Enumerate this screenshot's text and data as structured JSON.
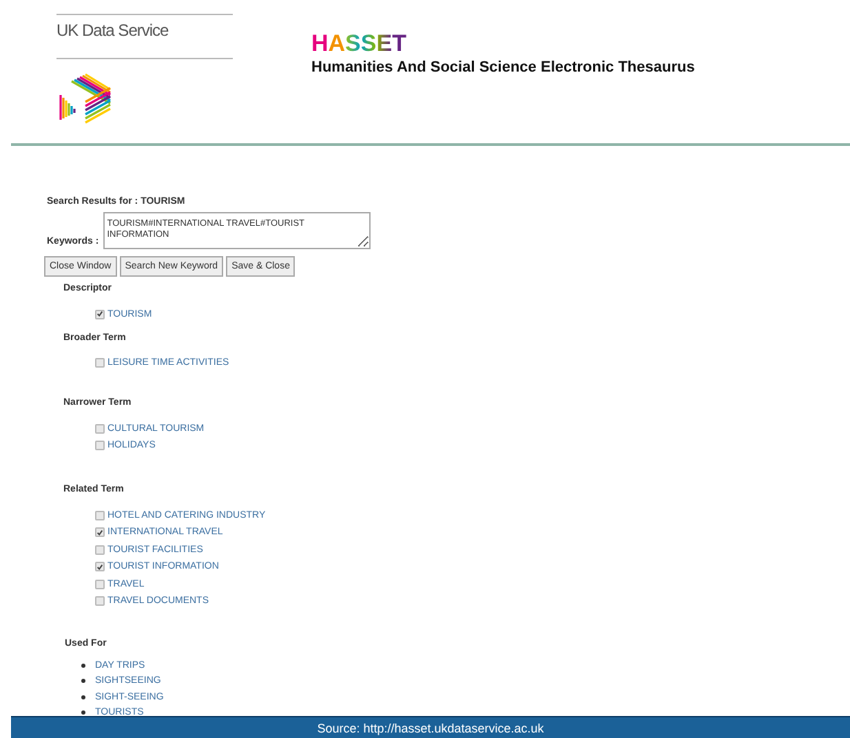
{
  "header": {
    "brand": "UK Data Service",
    "title": "HASSET",
    "subtitle": "Humanities And Social Science Electronic Thesaurus"
  },
  "search_results": "Search Results for : TOURISM",
  "keywords": {
    "label": "Keywords :",
    "value": "TOURISM#INTERNATIONAL TRAVEL#TOURIST INFORMATION"
  },
  "buttons": [
    "Close Window",
    "Search New Keyword",
    "Save & Close"
  ],
  "sections": [
    {
      "title": "Descriptor",
      "kind": "checkbox",
      "items": [
        {
          "label": "TOURISM",
          "checked": true
        }
      ]
    },
    {
      "title": "Broader Term",
      "kind": "checkbox",
      "items": [
        {
          "label": "LEISURE TIME ACTIVITIES",
          "checked": false
        }
      ]
    },
    {
      "title": "Narrower Term",
      "kind": "checkbox",
      "items": [
        {
          "label": "CULTURAL TOURISM",
          "checked": false
        },
        {
          "label": "HOLIDAYS",
          "checked": false
        }
      ]
    },
    {
      "title": "Related Term",
      "kind": "checkbox",
      "items": [
        {
          "label": "HOTEL AND CATERING INDUSTRY",
          "checked": false
        },
        {
          "label": "INTERNATIONAL TRAVEL",
          "checked": true
        },
        {
          "label": "TOURIST FACILITIES",
          "checked": false
        },
        {
          "label": "TOURIST INFORMATION",
          "checked": true
        },
        {
          "label": "TRAVEL",
          "checked": false
        },
        {
          "label": "TRAVEL DOCUMENTS",
          "checked": false
        }
      ]
    },
    {
      "title": "Used For",
      "kind": "bullet",
      "items": [
        {
          "label": "DAY TRIPS"
        },
        {
          "label": "SIGHTSEEING"
        },
        {
          "label": "SIGHT-SEEING"
        },
        {
          "label": "TOURISTS"
        }
      ]
    }
  ],
  "footer": "Source: http://hasset.ukdataservice.ac.uk"
}
